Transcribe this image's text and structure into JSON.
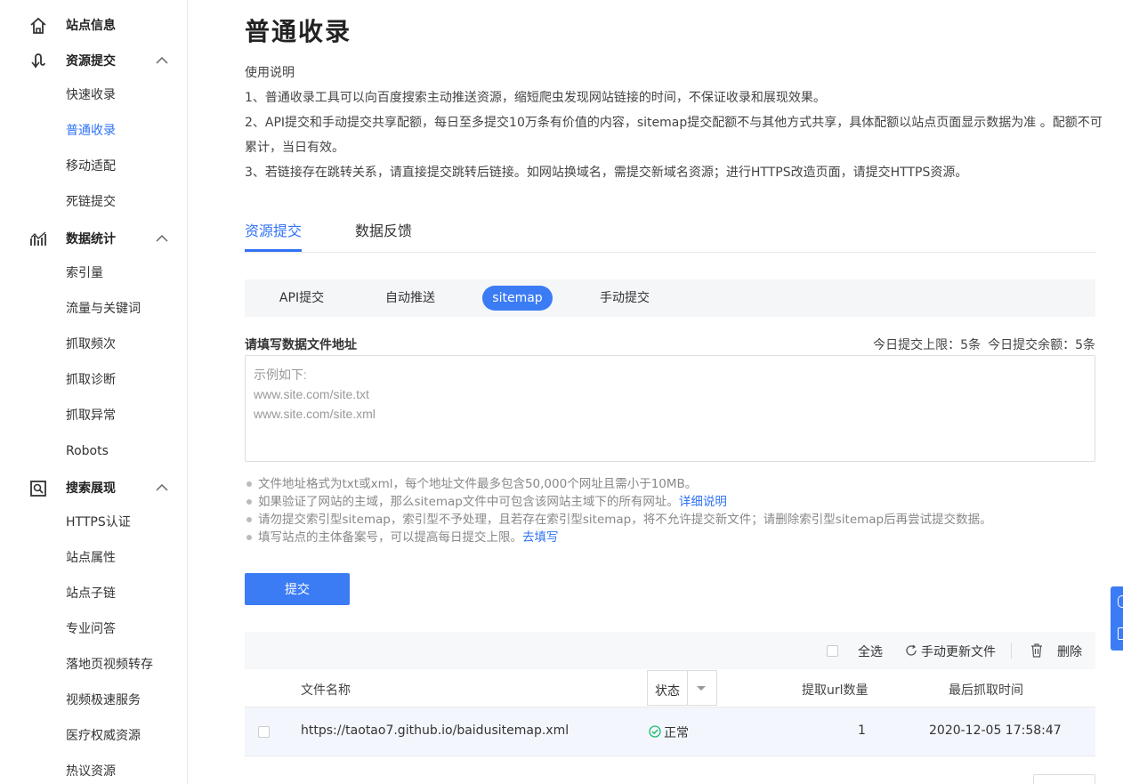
{
  "sidebar": {
    "groups": [
      {
        "label": "站点信息",
        "icon": "home-icon"
      },
      {
        "label": "资源提交",
        "icon": "submit-icon"
      },
      {
        "label": "数据统计",
        "icon": "stats-icon"
      },
      {
        "label": "搜索展现",
        "icon": "search-display-icon"
      }
    ],
    "items": [
      "快速收录",
      "普通收录",
      "移动适配",
      "死链提交",
      "索引量",
      "流量与关键词",
      "抓取频次",
      "抓取诊断",
      "抓取异常",
      "Robots",
      "HTTPS认证",
      "站点属性",
      "站点子链",
      "专业问答",
      "落地页视频转存",
      "视频极速服务",
      "医疗权威资源",
      "热议资源"
    ],
    "active_item": "普通收录"
  },
  "page": {
    "title": "普通收录",
    "instructions_heading": "使用说明",
    "instructions": [
      "1、普通收录工具可以向百度搜索主动推送资源，缩短爬虫发现网站链接的时间，不保证收录和展现效果。",
      "2、API提交和手动提交共享配额，每日至多提交10万条有价值的内容，sitemap提交配额不与其他方式共享，具体配额以站点页面显示数据为准 。配额不可",
      "累计，当日有效。",
      "3、若链接存在跳转关系，请直接提交跳转后链接。如网站换域名，需提交新域名资源；进行HTTPS改造页面，请提交HTTPS资源。"
    ]
  },
  "tabs": [
    "资源提交",
    "数据反馈"
  ],
  "active_tab": "资源提交",
  "methods": [
    "API提交",
    "自动推送",
    "sitemap",
    "手动提交"
  ],
  "active_method": "sitemap",
  "form": {
    "label": "请填写数据文件地址",
    "quota_limit": "今日提交上限：5条",
    "quota_remaining": "今日提交余额：5条",
    "placeholder": "示例如下:\nwww.site.com/site.txt\nwww.site.com/site.xml",
    "notes": [
      {
        "text": "文件地址格式为txt或xml，每个地址文件最多包含50,000个网址且需小于10MB。",
        "link": ""
      },
      {
        "text": "如果验证了网站的主域，那么sitemap文件中可包含该网站主域下的所有网址。",
        "link": "详细说明"
      },
      {
        "text": "请勿提交索引型sitemap，索引型不予处理，且若存在索引型sitemap，将不允许提交新文件；请删除索引型sitemap后再尝试提交数据。",
        "link": ""
      },
      {
        "text": "填写站点的主体备案号，可以提高每日提交上限。",
        "link": "去填写"
      }
    ],
    "submit_label": "提交"
  },
  "table": {
    "toolbar": {
      "select_all": "全选",
      "refresh": "手动更新文件",
      "delete": "删除"
    },
    "columns": {
      "file": "文件名称",
      "status": "状态",
      "url_count": "提取url数量",
      "last_crawl": "最后抓取时间"
    },
    "rows": [
      {
        "file": "https://taotao7.github.io/baidusitemap.xml",
        "status": "正常",
        "url_count": "1",
        "last_crawl": "2020-12-05 17:58:47"
      }
    ]
  },
  "colors": {
    "accent": "#3b7cf5",
    "link": "#3072f6",
    "ok": "#19be6b"
  }
}
